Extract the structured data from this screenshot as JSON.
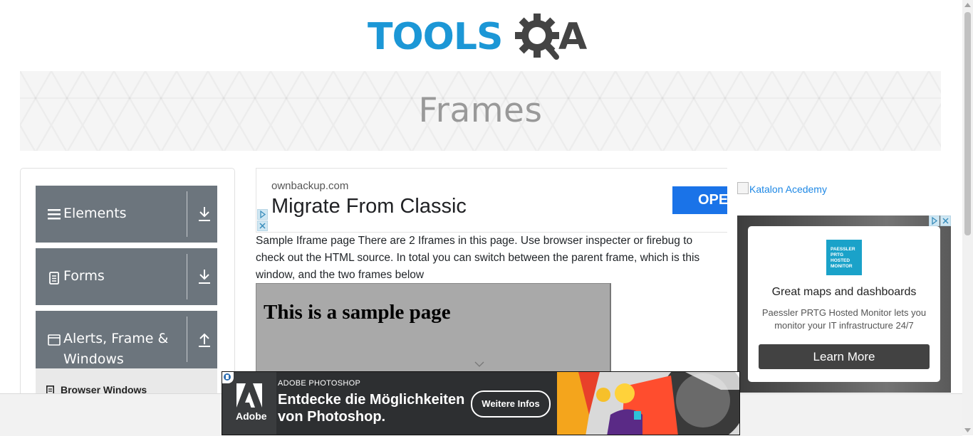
{
  "header": {
    "logo_text_left": "TOOLS",
    "logo_text_right": "A"
  },
  "banner": {
    "title": "Frames"
  },
  "sidebar": {
    "groups": [
      {
        "label": "Elements",
        "icon": "hamburger-icon",
        "arrow": "download-arrow-icon"
      },
      {
        "label": "Forms",
        "icon": "document-icon",
        "arrow": "download-arrow-icon"
      },
      {
        "label": "Alerts, Frame &\nWindows",
        "icon": "window-icon",
        "arrow": "upload-arrow-icon"
      }
    ],
    "sub_items": [
      {
        "label": "Browser Windows"
      }
    ]
  },
  "ad_top": {
    "domain": "ownbackup.com",
    "headline": "Migrate From Classic",
    "cta": "OPEN"
  },
  "main": {
    "intro": "Sample Iframe page There are 2 Iframes in this page. Use browser inspecter or firebug to check out the HTML source. In total you can switch between the parent frame, which is this window, and the two frames below",
    "iframe_heading": "This is a sample page"
  },
  "right_ad": {
    "katalon_alt": "Katalon Acedemy",
    "prtg_logo_text": "PAESSLER PRTG HOSTED MONITOR",
    "prtg_title": "Great maps and dashboards",
    "prtg_desc": "Paessler PRTG Hosted Monitor lets you monitor your IT infrastructure 24/7",
    "prtg_cta": "Learn More"
  },
  "bottom_ad": {
    "logo_word": "Adobe",
    "kicker": "ADOBE PHOTOSHOP",
    "headline_line1": "Entdecke die Möglichkeiten",
    "headline_line2": "von Photoshop.",
    "cta": "Weitere Infos"
  },
  "colors": {
    "logo_blue": "#1c97d6",
    "logo_gray": "#444444",
    "sidebar_group_bg": "#6c757d",
    "ad_blue": "#1a73e8"
  }
}
